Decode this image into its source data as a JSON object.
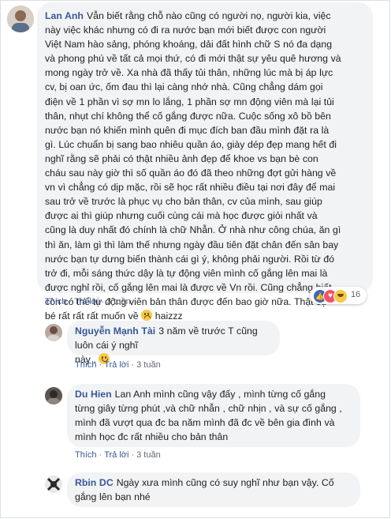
{
  "main_comment": {
    "author": "Lan Anh",
    "lines": [
      "Vẫn biết rằng chỗ nào cũng có người nọ, người kia, việc",
      "này việc khác nhưng có đi ra nước bạn mới biết được con người",
      "Việt Nam hào sảng, phóng khoáng, dải đất hình chữ S nó đa dạng",
      "và phong phú về tất cả mọi thứ, có đi mới thật sự yêu quê hương và",
      "mong ngày trở về. Xa nhà đã thấy tủi thân, những lúc mà bị áp lực",
      "cv, bị oan ức, ốm đau thì lại càng nhớ nhà. Cũng chẳng dám gọi",
      "điện về 1 phần vì sợ mn lo lắng, 1 phần sợ mn động viên mà lại tủi",
      "thân, nhụt chí không thể cố gắng được nữa. Cuộc sống xô bồ bên",
      "nước bạn nó khiến mình quên đi mục đích ban đầu mình đặt ra là",
      "gì. Lúc chuẩn bị sang bao nhiêu quần áo, giày dép đẹp mang hết đi",
      "nghĩ rằng sẽ phải có thật nhiều ảnh đẹp để khoe vs bạn bè con",
      "cháu sau này giờ thì số quần áo đó đã theo những đợt gửi hàng về",
      "vn vì chẳng có dịp mặc, rồi sẽ học rất nhiều điều tại nơi đây để mai",
      "sau trở về trước là phục vụ cho bản thân, cv của mình, sau giúp",
      "được ai thì giúp nhưng cuối cùng cái mà học được giỏi nhất và",
      "cũng là duy nhất đó chính là chữ Nhẫn. Ở nhà như công chúa, ăn gì",
      "thì ăn, làm gì thì làm thế nhưng ngày đầu tiên đặt chân đến sân bay",
      "nước bạn tự dưng biến thành cái gì ý, không phải người. Rồi từ đó",
      "trở đi, mỗi sáng thức dậy là tự động viên mình cố gắng lên mai là",
      "được nghỉ rồi, cố gắng lên mai là được về Vn rồi. Cũng chẳng biết",
      "còn có thể tự động viên bản thân được đến bao giờ nữa. Thật sự",
      "bé rất rất rất muốn về"
    ],
    "tail": " haizzz",
    "reaction_count": "16",
    "meta": {
      "like": "Thích",
      "reply": "Trả lời",
      "time": "3 tuần"
    }
  },
  "replies": [
    {
      "author": "Nguyễn Mạnh Tài",
      "lines": [
        "3 năm về trước T cũng luôn cái ý nghĩ",
        "này ."
      ],
      "meta": {
        "like": "Thích",
        "reply": "Trả lời",
        "time": "3 tuần"
      }
    },
    {
      "author": "Du Hien",
      "lines": [
        "Lan Anh mình cũng vậy đấy , mình từng cố gắng",
        "từng giây từng phút ,và chữ nhẫn , chữ nhịn , và sự cố gắng ,",
        "mình đã vượt qua đc ba năm mình đã đc về bên gia đình và",
        "mình học đc rất nhiều cho bản thân"
      ],
      "meta": {
        "like": "Thích",
        "reply": "Trả lời",
        "time": "3 tuần"
      }
    },
    {
      "author": "Rbin DC",
      "lines": [
        "Ngày xưa mình cũng có suy nghĩ như bạn vậy. Cố",
        "gắng lên bạn nhé"
      ]
    }
  ],
  "colors": {
    "name": "#385898",
    "bubble": "#f2f3f5",
    "meta": "#606770",
    "like_blue": "#4267b2"
  }
}
